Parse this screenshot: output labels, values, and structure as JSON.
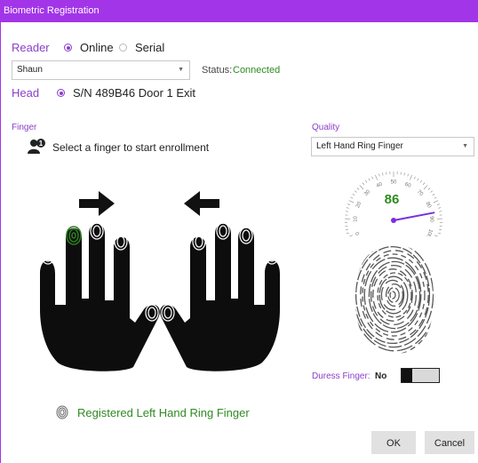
{
  "window": {
    "title": "Biometric Registration"
  },
  "reader": {
    "label": "Reader",
    "options": [
      {
        "label": "Online",
        "selected": true
      },
      {
        "label": "Serial",
        "selected": false
      }
    ],
    "selected_user": "Shaun",
    "status_label": "Status:",
    "status_value": "Connected"
  },
  "head": {
    "label": "Head",
    "value": "S/N 489B46 Door 1 Exit",
    "selected": true
  },
  "finger": {
    "section_label": "Finger",
    "instruction": "Select a finger to start enrollment",
    "selected_finger": "Left Hand Ring Finger",
    "registered_text": "Registered Left Hand Ring Finger"
  },
  "quality": {
    "section_label": "Quality",
    "selected": "Left Hand Ring Finger",
    "value": 86,
    "scale_labels": [
      "0",
      "10",
      "20",
      "30",
      "40",
      "50",
      "60",
      "70",
      "80",
      "90",
      "100"
    ]
  },
  "duress": {
    "label": "Duress Finger:",
    "value": "No",
    "toggle_on": false
  },
  "buttons": {
    "ok": "OK",
    "cancel": "Cancel"
  },
  "colors": {
    "accent": "#8a3ec9",
    "titlebar": "#a235e8",
    "success": "#2e8b22",
    "finger_selected": "#2a7a1e"
  }
}
